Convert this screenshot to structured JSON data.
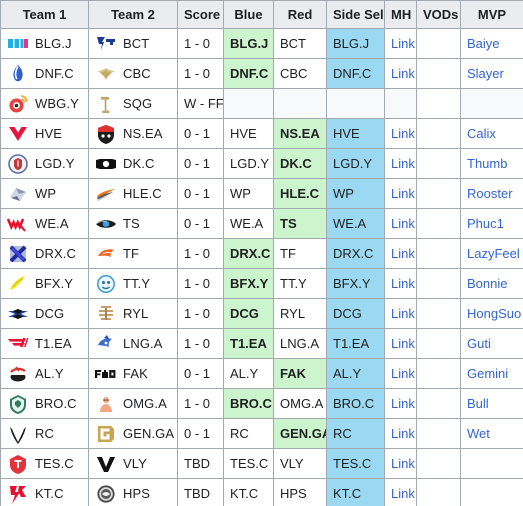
{
  "table": {
    "headers": [
      "Team 1",
      "Team 2",
      "Score",
      "Blue",
      "Red",
      "Side Sel",
      "MH",
      "VODs",
      "MVP"
    ],
    "colors": {
      "header_bg": "#eaecf0",
      "border": "#a2a9b1",
      "pick_green": "#cdf5cd",
      "side_blue": "#9bd9f2",
      "empty_gray": "#f8f9fa",
      "link_blue": "#3366cc",
      "text": "#202122"
    },
    "rows": [
      {
        "team1": "BLG.J",
        "team1_logo": "blg-logo",
        "team2": "BCT",
        "team2_logo": "bct-logo",
        "score": "1 - 0",
        "blue": "BLG.J",
        "blue_pick": true,
        "red": "BCT",
        "red_pick": false,
        "side_sel": "BLG.J",
        "mh": "Link",
        "vods": "",
        "mvp": "Baiye"
      },
      {
        "team1": "DNF.C",
        "team1_logo": "dnf-logo",
        "team2": "CBC",
        "team2_logo": "cbc-logo",
        "score": "1 - 0",
        "blue": "DNF.C",
        "blue_pick": true,
        "red": "CBC",
        "red_pick": false,
        "side_sel": "DNF.C",
        "mh": "Link",
        "vods": "",
        "mvp": "Slayer"
      },
      {
        "team1": "WBG.Y",
        "team1_logo": "wbg-logo",
        "team2": "SQG",
        "team2_logo": "sqg-logo",
        "score": "W - FF",
        "blue": "",
        "blue_pick": false,
        "red": "",
        "red_pick": false,
        "side_sel": "",
        "mh": "",
        "vods": "",
        "mvp": "",
        "forfeit": true
      },
      {
        "team1": "HVE",
        "team1_logo": "hve-logo",
        "team2": "NS.EA",
        "team2_logo": "ns-logo",
        "score": "0 - 1",
        "blue": "HVE",
        "blue_pick": false,
        "red": "NS.EA",
        "red_pick": true,
        "side_sel": "HVE",
        "mh": "Link",
        "vods": "",
        "mvp": "Calix"
      },
      {
        "team1": "LGD.Y",
        "team1_logo": "lgd-logo",
        "team2": "DK.C",
        "team2_logo": "dk-logo",
        "score": "0 - 1",
        "blue": "LGD.Y",
        "blue_pick": false,
        "red": "DK.C",
        "red_pick": true,
        "side_sel": "LGD.Y",
        "mh": "Link",
        "vods": "",
        "mvp": "Thumb"
      },
      {
        "team1": "WP",
        "team1_logo": "wp-logo",
        "team2": "HLE.C",
        "team2_logo": "hle-logo",
        "score": "0 - 1",
        "blue": "WP",
        "blue_pick": false,
        "red": "HLE.C",
        "red_pick": true,
        "side_sel": "WP",
        "mh": "Link",
        "vods": "",
        "mvp": "Rooster"
      },
      {
        "team1": "WE.A",
        "team1_logo": "we-logo",
        "team2": "TS",
        "team2_logo": "ts-logo",
        "score": "0 - 1",
        "blue": "WE.A",
        "blue_pick": false,
        "red": "TS",
        "red_pick": true,
        "side_sel": "WE.A",
        "mh": "Link",
        "vods": "",
        "mvp": "Phuc1"
      },
      {
        "team1": "DRX.C",
        "team1_logo": "drx-logo",
        "team2": "TF",
        "team2_logo": "tf-logo",
        "score": "1 - 0",
        "blue": "DRX.C",
        "blue_pick": true,
        "red": "TF",
        "red_pick": false,
        "side_sel": "DRX.C",
        "mh": "Link",
        "vods": "",
        "mvp": "LazyFeel"
      },
      {
        "team1": "BFX.Y",
        "team1_logo": "bfx-logo",
        "team2": "TT.Y",
        "team2_logo": "tt-logo",
        "score": "1 - 0",
        "blue": "BFX.Y",
        "blue_pick": true,
        "red": "TT.Y",
        "red_pick": false,
        "side_sel": "BFX.Y",
        "mh": "Link",
        "vods": "",
        "mvp": "Bonnie"
      },
      {
        "team1": "DCG",
        "team1_logo": "dcg-logo",
        "team2": "RYL",
        "team2_logo": "ryl-logo",
        "score": "1 - 0",
        "blue": "DCG",
        "blue_pick": true,
        "red": "RYL",
        "red_pick": false,
        "side_sel": "DCG",
        "mh": "Link",
        "vods": "",
        "mvp": "HongSuo"
      },
      {
        "team1": "T1.EA",
        "team1_logo": "t1-logo",
        "team2": "LNG.A",
        "team2_logo": "lng-logo",
        "score": "1 - 0",
        "blue": "T1.EA",
        "blue_pick": true,
        "red": "LNG.A",
        "red_pick": false,
        "side_sel": "T1.EA",
        "mh": "Link",
        "vods": "",
        "mvp": "Guti"
      },
      {
        "team1": "AL.Y",
        "team1_logo": "al-logo",
        "team2": "FAK",
        "team2_logo": "fak-logo",
        "score": "0 - 1",
        "blue": "AL.Y",
        "blue_pick": false,
        "red": "FAK",
        "red_pick": true,
        "side_sel": "AL.Y",
        "mh": "Link",
        "vods": "",
        "mvp": "Gemini"
      },
      {
        "team1": "BRO.C",
        "team1_logo": "bro-logo",
        "team2": "OMG.A",
        "team2_logo": "omg-logo",
        "score": "1 - 0",
        "blue": "BRO.C",
        "blue_pick": true,
        "red": "OMG.A",
        "red_pick": false,
        "side_sel": "BRO.C",
        "mh": "Link",
        "vods": "",
        "mvp": "Bull"
      },
      {
        "team1": "RC",
        "team1_logo": "rc-logo",
        "team2": "GEN.GA",
        "team2_logo": "gen-logo",
        "score": "0 - 1",
        "blue": "RC",
        "blue_pick": false,
        "red": "GEN.GA",
        "red_pick": true,
        "side_sel": "RC",
        "mh": "Link",
        "vods": "",
        "mvp": "Wet"
      },
      {
        "team1": "TES.C",
        "team1_logo": "tes-logo",
        "team2": "VLY",
        "team2_logo": "vly-logo",
        "score": "TBD",
        "blue": "TES.C",
        "blue_pick": false,
        "red": "VLY",
        "red_pick": false,
        "side_sel": "TES.C",
        "mh": "Link",
        "vods": "",
        "mvp": ""
      },
      {
        "team1": "KT.C",
        "team1_logo": "kt-logo",
        "team2": "HPS",
        "team2_logo": "hps-logo",
        "score": "TBD",
        "blue": "KT.C",
        "blue_pick": false,
        "red": "HPS",
        "red_pick": false,
        "side_sel": "KT.C",
        "mh": "Link",
        "vods": "",
        "mvp": ""
      }
    ]
  }
}
